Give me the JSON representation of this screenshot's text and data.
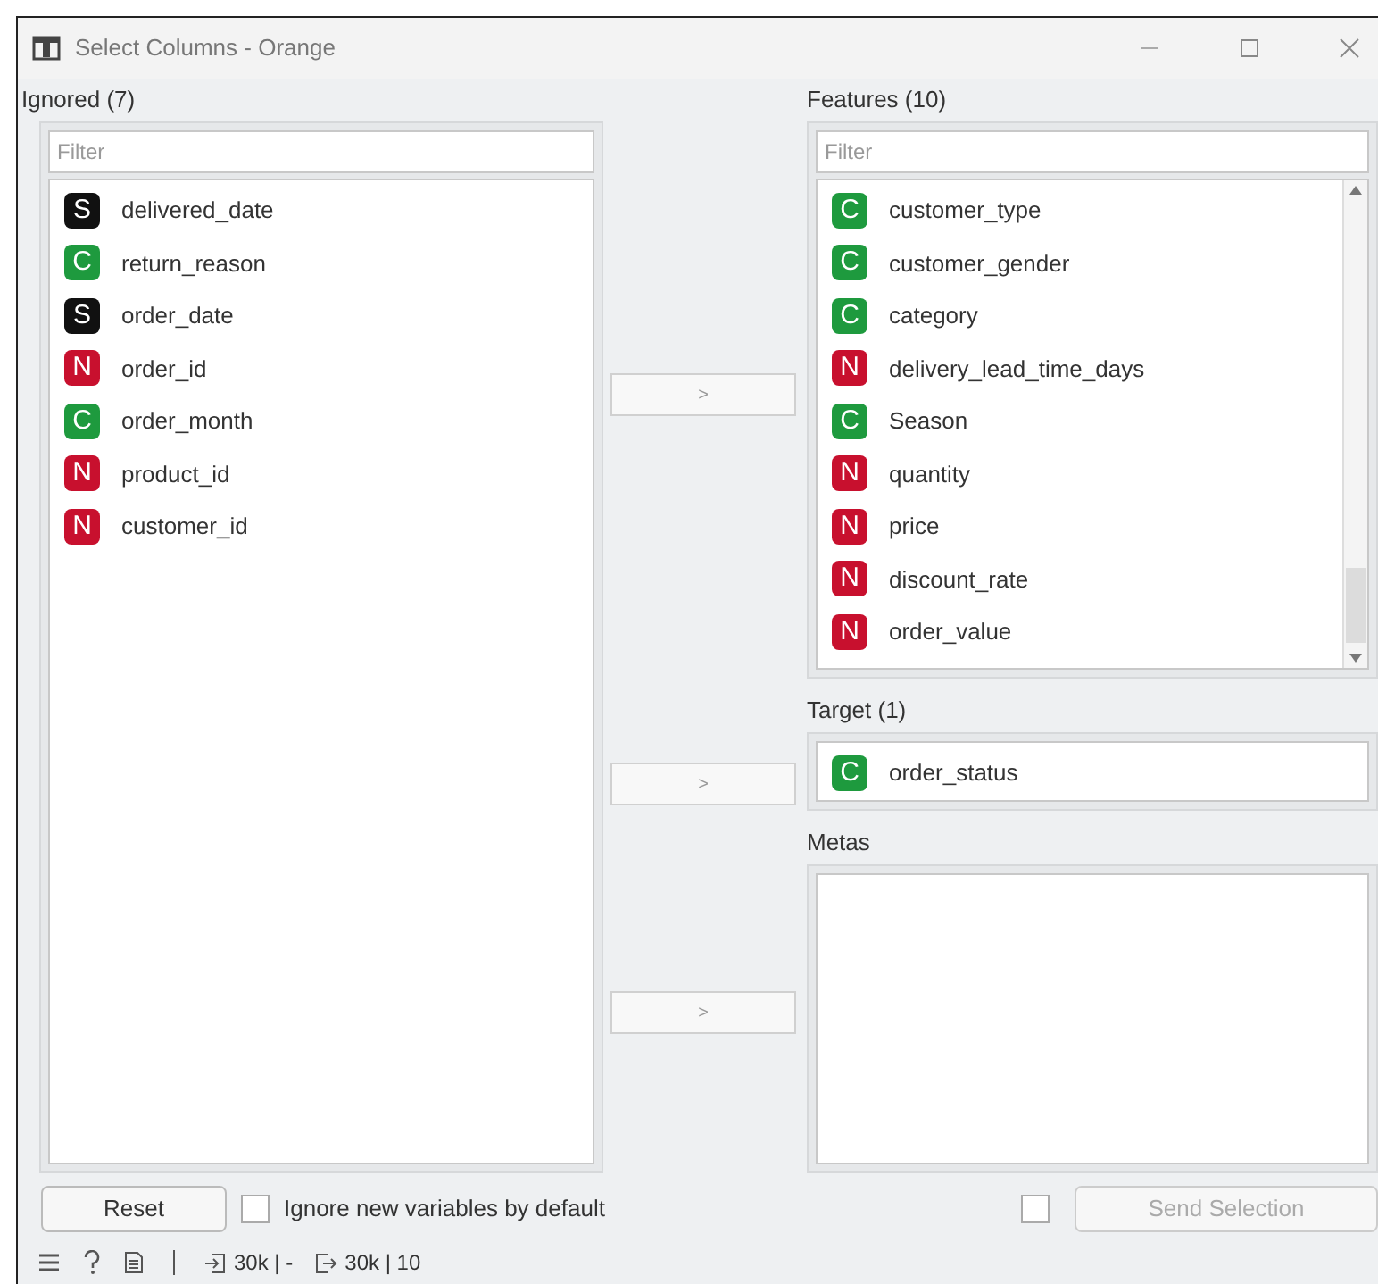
{
  "window": {
    "title": "Select Columns - Orange"
  },
  "ignored": {
    "label": "Ignored (7)",
    "filter": {
      "placeholder": "Filter"
    },
    "items": [
      {
        "type": "S",
        "name": "delivered_date"
      },
      {
        "type": "C",
        "name": "return_reason"
      },
      {
        "type": "S",
        "name": "order_date"
      },
      {
        "type": "N",
        "name": "order_id"
      },
      {
        "type": "C",
        "name": "order_month"
      },
      {
        "type": "N",
        "name": "product_id"
      },
      {
        "type": "N",
        "name": "customer_id"
      }
    ]
  },
  "move_buttons": [
    ">",
    ">",
    ">"
  ],
  "features": {
    "label": "Features (10)",
    "filter": {
      "placeholder": "Filter"
    },
    "items": [
      {
        "type": "C",
        "name": "customer_type"
      },
      {
        "type": "C",
        "name": "customer_gender"
      },
      {
        "type": "C",
        "name": "category"
      },
      {
        "type": "N",
        "name": "delivery_lead_time_days"
      },
      {
        "type": "C",
        "name": "Season"
      },
      {
        "type": "N",
        "name": "quantity"
      },
      {
        "type": "N",
        "name": "price"
      },
      {
        "type": "N",
        "name": "discount_rate"
      },
      {
        "type": "N",
        "name": "order_value"
      }
    ]
  },
  "target": {
    "label": "Target (1)",
    "items": [
      {
        "type": "C",
        "name": "order_status"
      }
    ]
  },
  "metas": {
    "label": "Metas"
  },
  "reset_button": "Reset",
  "ignore_new": {
    "label": "Ignore new variables by default",
    "checked": false
  },
  "auto_send": {
    "checked": false
  },
  "send_button": {
    "label": "Send Selection",
    "disabled": true
  },
  "status_bar": {
    "input": "30k | -",
    "output": "30k | 10"
  }
}
